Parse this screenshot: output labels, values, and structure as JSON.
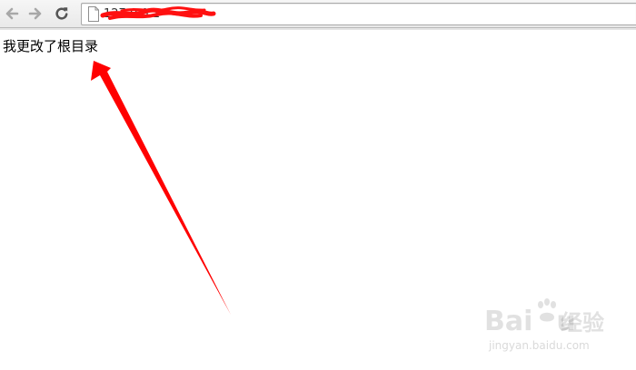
{
  "browser": {
    "url": "127.0.0.1",
    "icons": {
      "back": "arrow-left-icon",
      "forward": "arrow-right-icon",
      "reload": "reload-icon",
      "page": "page-icon"
    }
  },
  "content": {
    "text": "我更改了根目录"
  },
  "annotation": {
    "color": "#ff0000"
  },
  "watermark": {
    "brand": "Bai",
    "brand_suffix": "u",
    "cn": "经验",
    "url": "jingyan.baidu.com"
  }
}
